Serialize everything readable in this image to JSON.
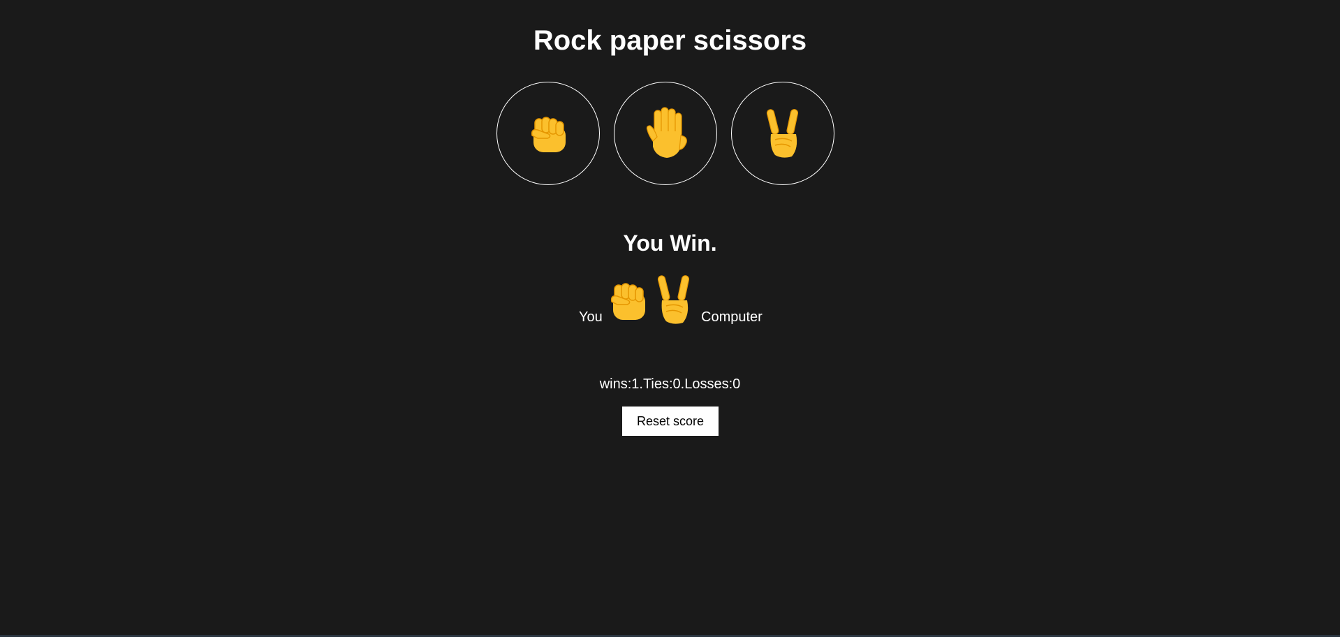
{
  "page": {
    "title": "Rock paper scissors"
  },
  "moves": [
    {
      "name": "rock",
      "icon": "raised-fist-icon"
    },
    {
      "name": "paper",
      "icon": "raised-hand-icon"
    },
    {
      "name": "scissors",
      "icon": "victory-hand-icon"
    }
  ],
  "result": {
    "text": "You Win.",
    "you_label": "You",
    "computer_label": "Computer",
    "you_move_icon": "raised-fist-icon",
    "computer_move_icon": "victory-hand-icon"
  },
  "score": {
    "text": "wins:1.Ties:0.Losses:0",
    "wins": 1,
    "ties": 0,
    "losses": 0
  },
  "reset_button": {
    "label": "Reset score"
  },
  "colors": {
    "background": "#1a1a1a",
    "emoji_yellow": "#fbc02d",
    "emoji_shade": "#e59600"
  }
}
